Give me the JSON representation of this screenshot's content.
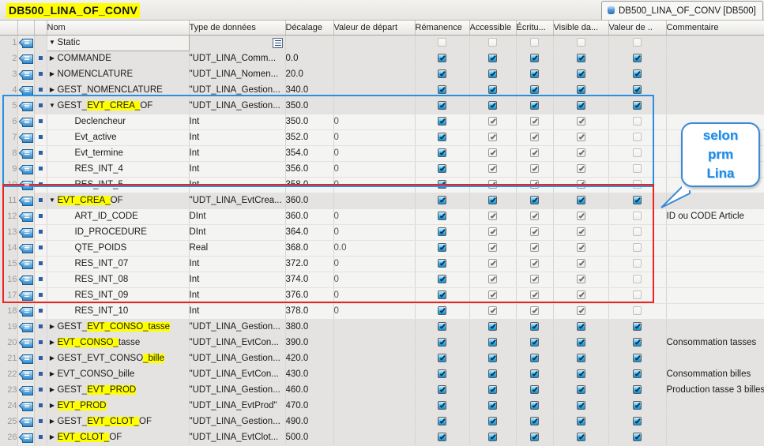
{
  "window": {
    "doc_title": "DB500_LINA_OF_CONV",
    "tab_label": "DB500_LINA_OF_CONV [DB500]",
    "tab_icon": "db-block-icon"
  },
  "table": {
    "columns": [
      {
        "key": "num",
        "label": ""
      },
      {
        "key": "icon",
        "label": ""
      },
      {
        "key": "dot",
        "label": ""
      },
      {
        "key": "name",
        "label": "Nom"
      },
      {
        "key": "type",
        "label": "Type de données"
      },
      {
        "key": "offset",
        "label": "Décalage"
      },
      {
        "key": "start",
        "label": "Valeur de départ"
      },
      {
        "key": "rem",
        "label": "Rémanence"
      },
      {
        "key": "acc",
        "label": "Accessible"
      },
      {
        "key": "wri",
        "label": "Écritu..."
      },
      {
        "key": "vis",
        "label": "Visible da..."
      },
      {
        "key": "val",
        "label": "Valeur de .."
      },
      {
        "key": "cmt",
        "label": "Commentaire"
      }
    ],
    "rows": [
      {
        "num": "1",
        "level": 0,
        "tri": "down",
        "name": "Static",
        "name_hl": [],
        "type": "",
        "type_icon": "list-icon",
        "offset": "",
        "start": "",
        "cb": [
          "empty",
          "empty",
          "empty",
          "empty",
          "empty"
        ],
        "cmt": "",
        "dot": false,
        "static": true
      },
      {
        "num": "2",
        "level": 0,
        "tri": "right",
        "name": "COMMANDE",
        "name_hl": [],
        "type": "\"UDT_LINA_Comm...",
        "offset": "0.0",
        "start": "",
        "cb": [
          "on",
          "on",
          "on",
          "on",
          "on"
        ],
        "cmt": "",
        "dot": true
      },
      {
        "num": "3",
        "level": 0,
        "tri": "right",
        "name": "NOMENCLATURE",
        "name_hl": [],
        "type": "\"UDT_LINA_Nomen...",
        "offset": "20.0",
        "start": "",
        "cb": [
          "on",
          "on",
          "on",
          "on",
          "on"
        ],
        "cmt": "",
        "dot": true
      },
      {
        "num": "4",
        "level": 0,
        "tri": "right",
        "name": "GEST_NOMENCLATURE",
        "name_hl": [],
        "type": "\"UDT_LINA_Gestion...",
        "offset": "340.0",
        "start": "",
        "cb": [
          "on",
          "on",
          "on",
          "on",
          "on"
        ],
        "cmt": "",
        "dot": true
      },
      {
        "num": "5",
        "level": 0,
        "tri": "down",
        "name": "GEST_EVT_CREA_OF",
        "name_hl": [
          "EVT_CREA_"
        ],
        "type": "\"UDT_LINA_Gestion...",
        "offset": "350.0",
        "start": "",
        "cb": [
          "on",
          "on",
          "on",
          "on",
          "on"
        ],
        "cmt": "",
        "dot": true
      },
      {
        "num": "6",
        "level": 1,
        "tri": "none",
        "name": "Declencheur",
        "name_hl": [],
        "type": "Int",
        "offset": "350.0",
        "start": "0",
        "cb": [
          "on",
          "dis",
          "dis",
          "dis",
          "empty"
        ],
        "cmt": "",
        "dot": true
      },
      {
        "num": "7",
        "level": 1,
        "tri": "none",
        "name": "Evt_active",
        "name_hl": [],
        "type": "Int",
        "offset": "352.0",
        "start": "0",
        "cb": [
          "on",
          "dis",
          "dis",
          "dis",
          "empty"
        ],
        "cmt": "",
        "dot": true
      },
      {
        "num": "8",
        "level": 1,
        "tri": "none",
        "name": "Evt_termine",
        "name_hl": [],
        "type": "Int",
        "offset": "354.0",
        "start": "0",
        "cb": [
          "on",
          "dis",
          "dis",
          "dis",
          "empty"
        ],
        "cmt": "",
        "dot": true
      },
      {
        "num": "9",
        "level": 1,
        "tri": "none",
        "name": "RES_INT_4",
        "name_hl": [],
        "type": "Int",
        "offset": "356.0",
        "start": "0",
        "cb": [
          "on",
          "dis",
          "dis",
          "dis",
          "empty"
        ],
        "cmt": "",
        "dot": true
      },
      {
        "num": "10",
        "level": 1,
        "tri": "none",
        "name": "RES_INT_5",
        "name_hl": [],
        "type": "Int",
        "offset": "358.0",
        "start": "0",
        "cb": [
          "on",
          "dis",
          "dis",
          "dis",
          "empty"
        ],
        "cmt": "",
        "dot": true
      },
      {
        "num": "11",
        "level": 0,
        "tri": "down",
        "name": "EVT_CREA_OF",
        "name_hl": [
          "EVT_CREA_"
        ],
        "type": "\"UDT_LINA_EvtCrea...",
        "offset": "360.0",
        "start": "",
        "cb": [
          "on",
          "on",
          "on",
          "on",
          "on"
        ],
        "cmt": "",
        "dot": true
      },
      {
        "num": "12",
        "level": 1,
        "tri": "none",
        "name": "ART_ID_CODE",
        "name_hl": [],
        "type": "DInt",
        "offset": "360.0",
        "start": "0",
        "cb": [
          "on",
          "dis",
          "dis",
          "dis",
          "empty"
        ],
        "cmt": "ID ou CODE Article",
        "dot": true
      },
      {
        "num": "13",
        "level": 1,
        "tri": "none",
        "name": "ID_PROCEDURE",
        "name_hl": [],
        "type": "DInt",
        "offset": "364.0",
        "start": "0",
        "cb": [
          "on",
          "dis",
          "dis",
          "dis",
          "empty"
        ],
        "cmt": "",
        "dot": true
      },
      {
        "num": "14",
        "level": 1,
        "tri": "none",
        "name": "QTE_POIDS",
        "name_hl": [],
        "type": "Real",
        "offset": "368.0",
        "start": "0.0",
        "cb": [
          "on",
          "dis",
          "dis",
          "dis",
          "empty"
        ],
        "cmt": "",
        "dot": true
      },
      {
        "num": "15",
        "level": 1,
        "tri": "none",
        "name": "RES_INT_07",
        "name_hl": [],
        "type": "Int",
        "offset": "372.0",
        "start": "0",
        "cb": [
          "on",
          "dis",
          "dis",
          "dis",
          "empty"
        ],
        "cmt": "",
        "dot": true
      },
      {
        "num": "16",
        "level": 1,
        "tri": "none",
        "name": "RES_INT_08",
        "name_hl": [],
        "type": "Int",
        "offset": "374.0",
        "start": "0",
        "cb": [
          "on",
          "dis",
          "dis",
          "dis",
          "empty"
        ],
        "cmt": "",
        "dot": true
      },
      {
        "num": "17",
        "level": 1,
        "tri": "none",
        "name": "RES_INT_09",
        "name_hl": [],
        "type": "Int",
        "offset": "376.0",
        "start": "0",
        "cb": [
          "on",
          "dis",
          "dis",
          "dis",
          "empty"
        ],
        "cmt": "",
        "dot": true
      },
      {
        "num": "18",
        "level": 1,
        "tri": "none",
        "name": "RES_INT_10",
        "name_hl": [],
        "type": "Int",
        "offset": "378.0",
        "start": "0",
        "cb": [
          "on",
          "dis",
          "dis",
          "dis",
          "empty"
        ],
        "cmt": "",
        "dot": true
      },
      {
        "num": "19",
        "level": 0,
        "tri": "right",
        "name": "GEST_EVT_CONSO_tasse",
        "name_hl": [
          "EVT_CONSO_tasse"
        ],
        "type": "\"UDT_LINA_Gestion...",
        "offset": "380.0",
        "start": "",
        "cb": [
          "on",
          "on",
          "on",
          "on",
          "on"
        ],
        "cmt": "",
        "dot": true
      },
      {
        "num": "20",
        "level": 0,
        "tri": "right",
        "name": "EVT_CONSO_tasse",
        "name_hl": [
          "EVT_CONSO_"
        ],
        "type": "\"UDT_LINA_EvtCon...",
        "offset": "390.0",
        "start": "",
        "cb": [
          "on",
          "on",
          "on",
          "on",
          "on"
        ],
        "cmt": "Consommation tasses",
        "dot": true
      },
      {
        "num": "21",
        "level": 0,
        "tri": "right",
        "name": "GEST_EVT_CONSO_bille",
        "name_hl": [
          "_bille"
        ],
        "type": "\"UDT_LINA_Gestion...",
        "offset": "420.0",
        "start": "",
        "cb": [
          "on",
          "on",
          "on",
          "on",
          "on"
        ],
        "cmt": "",
        "dot": true
      },
      {
        "num": "22",
        "level": 0,
        "tri": "right",
        "name": "EVT_CONSO_bille",
        "name_hl": [],
        "type": "\"UDT_LINA_EvtCon...",
        "offset": "430.0",
        "start": "",
        "cb": [
          "on",
          "on",
          "on",
          "on",
          "on"
        ],
        "cmt": "Consommation billes",
        "dot": true
      },
      {
        "num": "23",
        "level": 0,
        "tri": "right",
        "name": "GEST_EVT_PROD",
        "name_hl": [
          "EVT_PROD"
        ],
        "type": "\"UDT_LINA_Gestion...",
        "offset": "460.0",
        "start": "",
        "cb": [
          "on",
          "on",
          "on",
          "on",
          "on"
        ],
        "cmt": "Production tasse 3 billes",
        "dot": true
      },
      {
        "num": "24",
        "level": 0,
        "tri": "right",
        "name": "EVT_PROD",
        "name_hl": [
          "EVT_PROD"
        ],
        "type": "\"UDT_LINA_EvtProd\"",
        "offset": "470.0",
        "start": "",
        "cb": [
          "on",
          "on",
          "on",
          "on",
          "on"
        ],
        "cmt": "",
        "dot": true
      },
      {
        "num": "25",
        "level": 0,
        "tri": "right",
        "name": "GEST_EVT_CLOT_OF",
        "name_hl": [
          "EVT_CLOT_"
        ],
        "type": "\"UDT_LINA_Gestion...",
        "offset": "490.0",
        "start": "",
        "cb": [
          "on",
          "on",
          "on",
          "on",
          "on"
        ],
        "cmt": "",
        "dot": true
      },
      {
        "num": "26",
        "level": 0,
        "tri": "right",
        "name": "EVT_CLOT_OF",
        "name_hl": [
          "EVT_CLOT_"
        ],
        "type": "\"UDT_LINA_EvtClot...",
        "offset": "500.0",
        "start": "",
        "cb": [
          "on",
          "on",
          "on",
          "on",
          "on"
        ],
        "cmt": "",
        "dot": true
      }
    ]
  },
  "annotations": {
    "callout_lines": [
      "selon",
      "prm",
      "Lina"
    ],
    "callout_target_text": "ID ou CODE Article",
    "blue_box_rows": "5-10",
    "red_box_rows": "11-18",
    "colors": {
      "highlight": "#ffff00",
      "blue_box": "#2a8fe0",
      "red_box": "#ee2222",
      "callout_text": "#1d8ae8",
      "checkbox_on": "#2fb8ef"
    }
  }
}
